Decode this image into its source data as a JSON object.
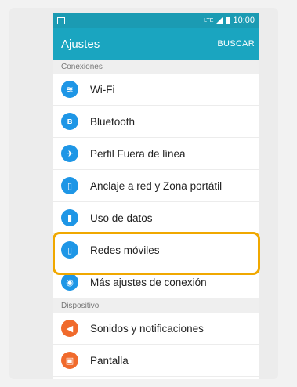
{
  "status_bar": {
    "network": "LTE",
    "time": "10:00"
  },
  "app_bar": {
    "title": "Ajustes",
    "action": "BUSCAR"
  },
  "sections": [
    {
      "header": "Conexiones",
      "items": [
        {
          "label": "Wi-Fi",
          "icon": "wifi-icon",
          "color": "#1e96e6",
          "glyph": "≋"
        },
        {
          "label": "Bluetooth",
          "icon": "bluetooth-icon",
          "color": "#1e96e6",
          "glyph": "ʙ"
        },
        {
          "label": "Perfil Fuera de línea",
          "icon": "airplane-icon",
          "color": "#1e96e6",
          "glyph": "✈"
        },
        {
          "label": "Anclaje a red y Zona portátil",
          "icon": "tethering-icon",
          "color": "#1e96e6",
          "glyph": "▯"
        },
        {
          "label": "Uso de datos",
          "icon": "data-usage-icon",
          "color": "#1e96e6",
          "glyph": "▮"
        },
        {
          "label": "Redes móviles",
          "icon": "mobile-networks-icon",
          "color": "#1e96e6",
          "glyph": "▯"
        },
        {
          "label": "Más ajustes de conexión",
          "icon": "more-connection-icon",
          "color": "#1e96e6",
          "glyph": "◉"
        }
      ]
    },
    {
      "header": "Dispositivo",
      "items": [
        {
          "label": "Sonidos y notificaciones",
          "icon": "sound-icon",
          "color": "#f06a2c",
          "glyph": "◀"
        },
        {
          "label": "Pantalla",
          "icon": "display-icon",
          "color": "#f06a2c",
          "glyph": "▣"
        }
      ]
    }
  ],
  "highlight_color": "#f0a800"
}
